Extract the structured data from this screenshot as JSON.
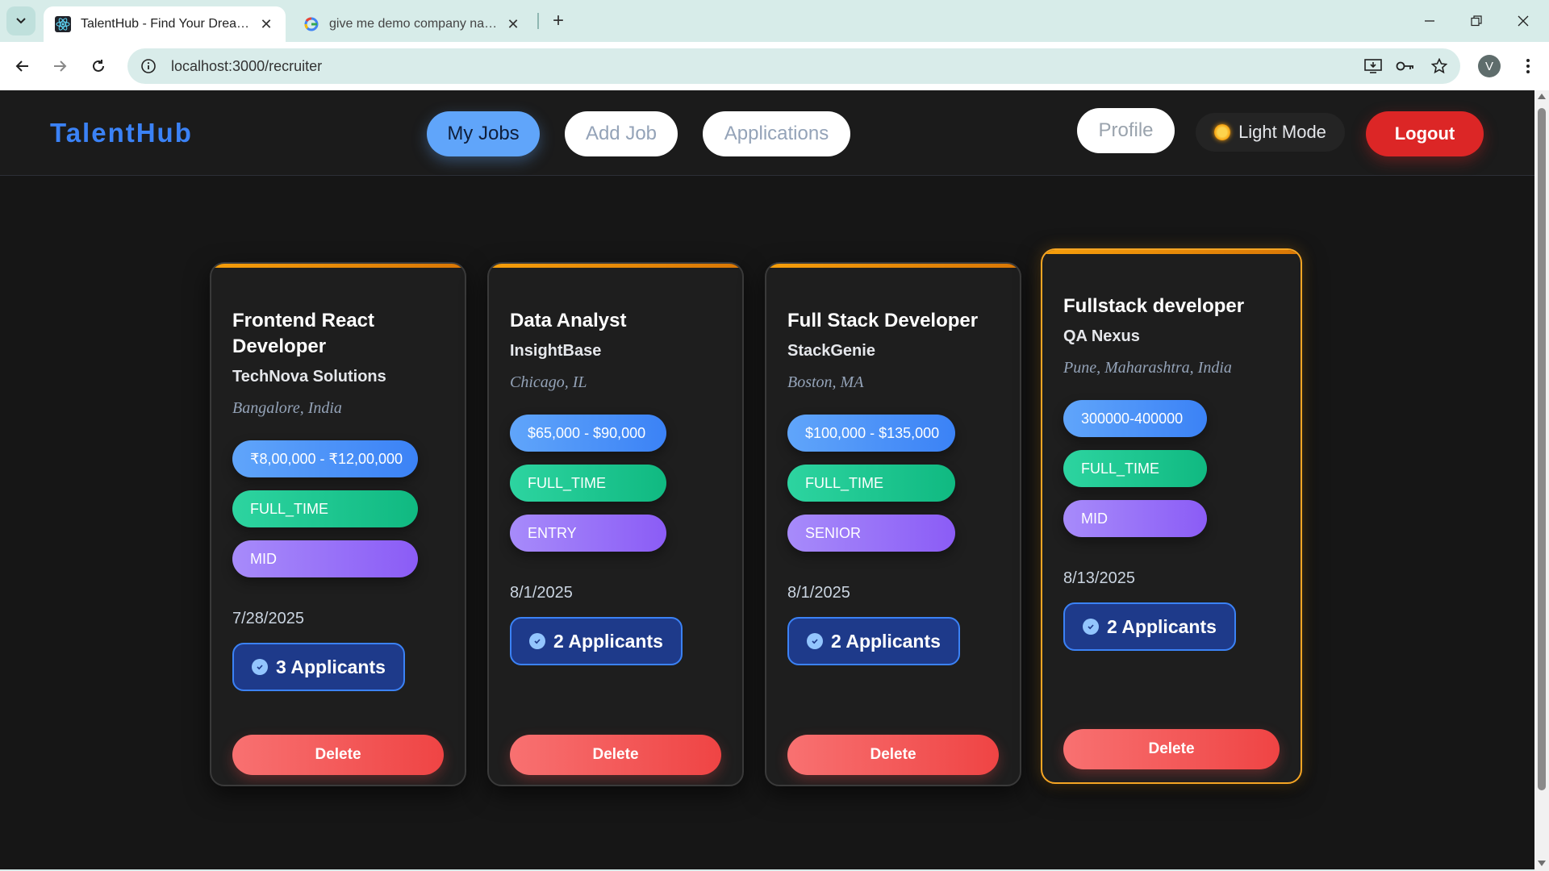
{
  "browser": {
    "tabs": [
      {
        "title": "TalentHub - Find Your Dream Jo",
        "active": true
      },
      {
        "title": "give me demo company name",
        "active": false
      }
    ],
    "url": "localhost:3000/recruiter",
    "profile_initial": "V"
  },
  "app": {
    "brand": "TalentHub",
    "nav": {
      "my_jobs": "My Jobs",
      "add_job": "Add Job",
      "applications": "Applications",
      "profile": "Profile",
      "light_mode": "Light Mode",
      "logout": "Logout"
    }
  },
  "jobs": [
    {
      "title": "Frontend React Developer",
      "company": "TechNova Solutions",
      "location": "Bangalore, India",
      "salary": "₹8,00,000 - ₹12,00,000",
      "type": "FULL_TIME",
      "level": "MID",
      "date": "7/28/2025",
      "applicants": "3 Applicants",
      "delete_label": "Delete"
    },
    {
      "title": "Data Analyst",
      "company": "InsightBase",
      "location": "Chicago, IL",
      "salary": "$65,000 - $90,000",
      "type": "FULL_TIME",
      "level": "ENTRY",
      "date": "8/1/2025",
      "applicants": "2 Applicants",
      "delete_label": "Delete"
    },
    {
      "title": "Full Stack Developer",
      "company": "StackGenie",
      "location": "Boston, MA",
      "salary": "$100,000 - $135,000",
      "type": "FULL_TIME",
      "level": "SENIOR",
      "date": "8/1/2025",
      "applicants": "2 Applicants",
      "delete_label": "Delete"
    },
    {
      "title": "Fullstack developer",
      "company": "QA Nexus",
      "location": "Pune, Maharashtra, India",
      "salary": "300000-400000",
      "type": "FULL_TIME",
      "level": "MID",
      "date": "8/13/2025",
      "applicants": "2 Applicants",
      "delete_label": "Delete"
    }
  ],
  "colors": {
    "brand": "#3b82f6",
    "card_accent": "#f59e0b",
    "salary_tag": "#3b82f6",
    "type_tag": "#10b981",
    "level_tag": "#8b5cf6",
    "delete": "#ef4444",
    "logout": "#dc2626"
  }
}
